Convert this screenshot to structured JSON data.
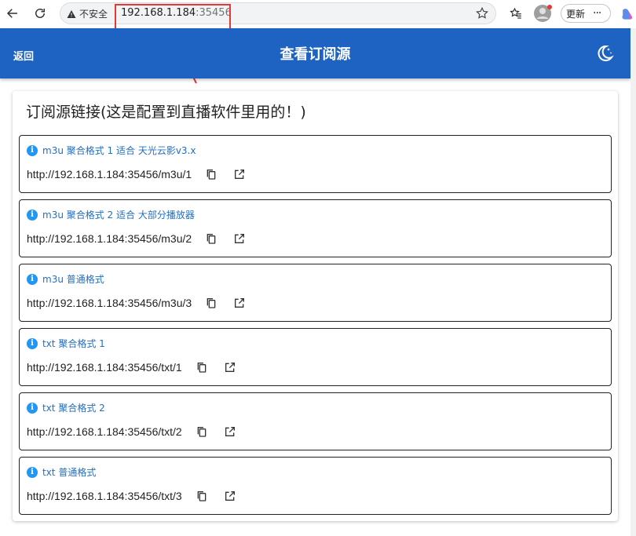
{
  "browser": {
    "security_label": "不安全",
    "url_host": "192.168.1.184",
    "url_port": ":35456",
    "update_label": "更新"
  },
  "appbar": {
    "back_label": "返回",
    "title": "查看订阅源"
  },
  "card": {
    "title": "订阅源链接(这是配置到直播软件里用的！)",
    "feeds": [
      {
        "label": "m3u 聚合格式 1 适合 天光云影v3.x",
        "url": "http://192.168.1.184:35456/m3u/1"
      },
      {
        "label": "m3u 聚合格式 2 适合 大部分播放器",
        "url": "http://192.168.1.184:35456/m3u/2"
      },
      {
        "label": "m3u 普通格式",
        "url": "http://192.168.1.184:35456/m3u/3"
      },
      {
        "label": "txt 聚合格式 1",
        "url": "http://192.168.1.184:35456/txt/1"
      },
      {
        "label": "txt 聚合格式 2",
        "url": "http://192.168.1.184:35456/txt/2"
      },
      {
        "label": "txt 普通格式",
        "url": "http://192.168.1.184:35456/txt/3"
      }
    ]
  },
  "icons": {
    "info": "info-icon",
    "copy": "copy-icon",
    "open": "open-external-icon",
    "theme": "dark-mode-icon"
  },
  "colors": {
    "appbar": "#1e63c2",
    "info": "#2196f3",
    "annotation": "#e53935"
  }
}
